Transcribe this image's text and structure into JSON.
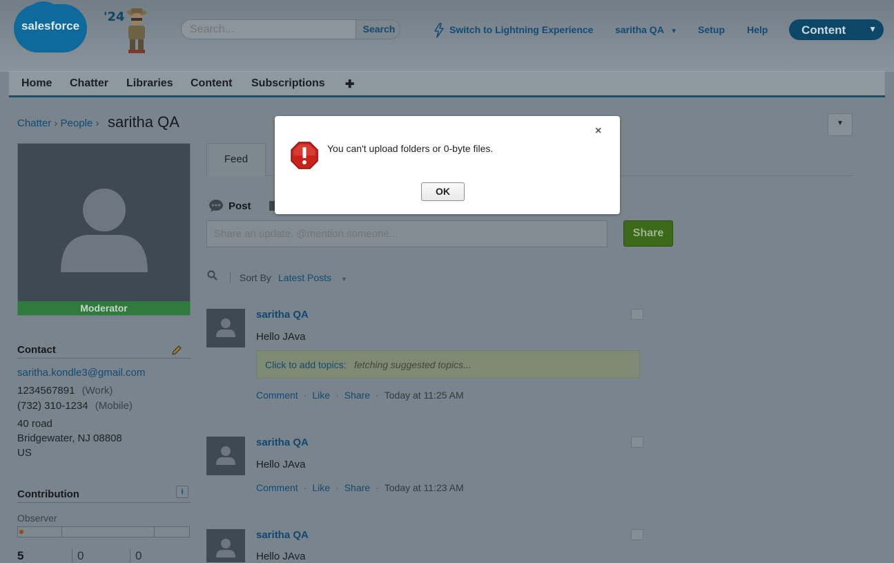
{
  "header": {
    "logo_text": "salesforce",
    "mascot_year": "'24",
    "search_placeholder": "Search...",
    "search_button": "Search",
    "switch_lightning": "Switch to Lightning Experience",
    "user_menu": "saritha QA",
    "setup": "Setup",
    "help": "Help",
    "app_menu": "Content"
  },
  "tabs": [
    "Home",
    "Chatter",
    "Libraries",
    "Content",
    "Subscriptions",
    "✚"
  ],
  "breadcrumb": {
    "chatter": "Chatter",
    "people": "People",
    "current": "saritha QA"
  },
  "profile": {
    "badge": "Moderator",
    "contact_title": "Contact",
    "email": "saritha.kondle3@gmail.com",
    "work_phone": "1234567891",
    "work_label": "(Work)",
    "mobile_phone": "(732) 310-1234",
    "mobile_label": "(Mobile)",
    "address_line1": "40 road",
    "address_line2": "Bridgewater, NJ 08808",
    "address_line3": "US",
    "contribution_title": "Contribution",
    "contribution_level": "Observer",
    "stats": [
      "5",
      "0",
      "0"
    ]
  },
  "feed": {
    "tab_label": "Feed",
    "post_label": "Post",
    "post_placeholder": "Share an update, @mention someone...",
    "share_button": "Share",
    "sort_by": "Sort By",
    "sort_value": "Latest Posts",
    "topics_label": "Click to add topics:",
    "topics_hint": "fetching suggested topics...",
    "action_comment": "Comment",
    "action_like": "Like",
    "action_share": "Share",
    "posts": [
      {
        "author": "saritha QA",
        "body": "Hello JAva",
        "time": "Today at 11:25 AM"
      },
      {
        "author": "saritha QA",
        "body": "Hello JAva",
        "time": "Today at 11:23 AM"
      },
      {
        "author": "saritha QA",
        "body": "Hello JAva"
      }
    ]
  },
  "dialog": {
    "message": "You can't upload folders or 0-byte files.",
    "ok_button": "OK",
    "close_glyph": "×"
  },
  "colors": {
    "brand": "#0e6a9b",
    "share": "#3b6a18",
    "link": "#114a72",
    "moderator": "#2f7a3c"
  }
}
